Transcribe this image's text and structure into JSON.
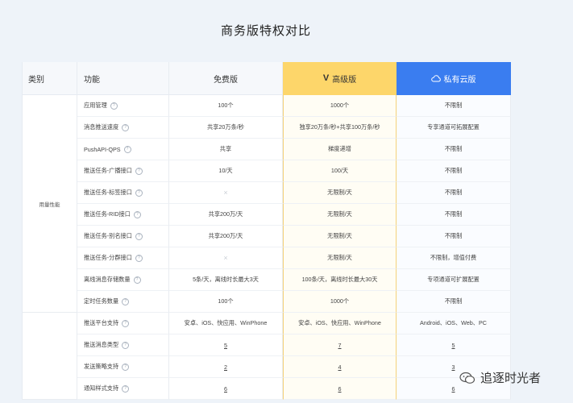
{
  "title": "商务版特权对比",
  "header": {
    "category": "类别",
    "feature": "功能",
    "free": "免费版",
    "advanced": "高级版",
    "private": "私有云版",
    "advanced_mark": "V"
  },
  "groups": [
    {
      "name": "用量性能",
      "rows": [
        {
          "feature": "应用管理",
          "free": "100个",
          "advanced": "1000个",
          "private": "不限制"
        },
        {
          "feature": "消息推送速度",
          "free": "共享20万条/秒",
          "advanced": "独享20万条/秒+共享100万条/秒",
          "private": "专享通道可拓展配置"
        },
        {
          "feature": "PushAPI-QPS",
          "free": "共享",
          "advanced": "梯度递增",
          "private": "不限制"
        },
        {
          "feature": "推送任务-广播接口",
          "free": "10/天",
          "advanced": "100/天",
          "private": "不限制"
        },
        {
          "feature": "推送任务-标签接口",
          "free": "×",
          "advanced": "无限制/天",
          "private": "不限制"
        },
        {
          "feature": "推送任务-RID接口",
          "free": "共享200万/天",
          "advanced": "无限制/天",
          "private": "不限制"
        },
        {
          "feature": "推送任务-别名接口",
          "free": "共享200万/天",
          "advanced": "无限制/天",
          "private": "不限制"
        },
        {
          "feature": "推送任务-分群接口",
          "free": "×",
          "advanced": "无限制/天",
          "private": "不限制，增值付费"
        },
        {
          "feature": "离线消息存储数量",
          "free": "5条/天，离线时长最大3天",
          "advanced": "100条/天，离线时长最大30天",
          "private": "专项通道可扩展配置"
        },
        {
          "feature": "定时任务数量",
          "free": "100个",
          "advanced": "1000个",
          "private": "不限制"
        }
      ]
    },
    {
      "name": "",
      "rows": [
        {
          "feature": "推送平台支持",
          "free": "安卓、iOS、快应用、WinPhone",
          "advanced": "安卓、iOS、快应用、WinPhone",
          "private": "Android、iOS、Web、PC"
        },
        {
          "feature": "推送消息类型",
          "free": "5",
          "advanced": "7",
          "private": "5"
        },
        {
          "feature": "发送策略支持",
          "free": "2",
          "advanced": "4",
          "private": "3"
        },
        {
          "feature": "通知样式支持",
          "free": "6",
          "advanced": "6",
          "private": "6"
        }
      ]
    }
  ],
  "watermark": "追逐时光者",
  "colors": {
    "advanced_header": "#fdd66a",
    "private_header": "#3a7df0"
  }
}
